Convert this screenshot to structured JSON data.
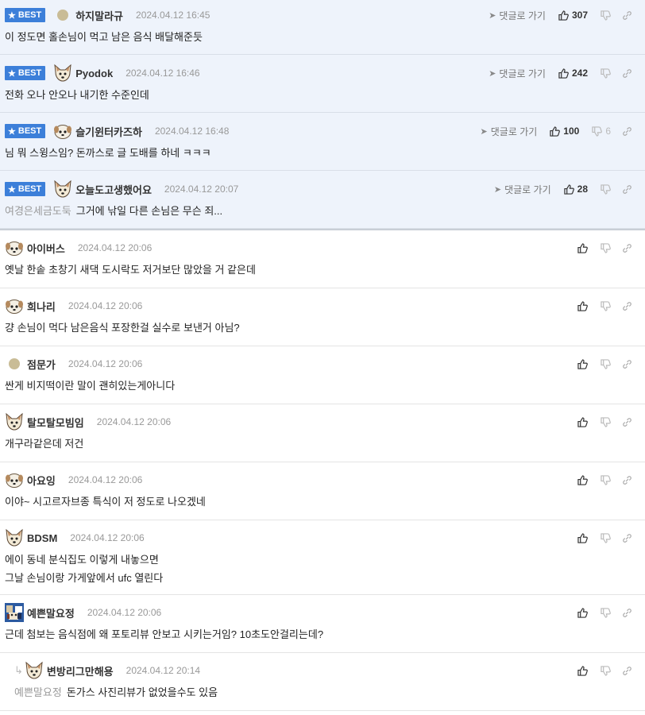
{
  "best_label": "BEST",
  "reply_link_label": "댓글로 가기",
  "best_comments": [
    {
      "avatar": "dot-avatar",
      "nick": "하지말라규",
      "date": "2024.04.12 16:45",
      "likes": "307",
      "dislikes": "",
      "quote": "",
      "text": "이 정도면 홀손님이 먹고 남은 음식 배달해준듯"
    },
    {
      "avatar": "fox-dog-avatar",
      "nick": "Pyodok",
      "date": "2024.04.12 16:46",
      "likes": "242",
      "dislikes": "",
      "quote": "",
      "text": "전화 오나 안오나 내기한 수준인데"
    },
    {
      "avatar": "puppy-avatar",
      "nick": "슬기윈터카즈하",
      "date": "2024.04.12 16:48",
      "likes": "100",
      "dislikes": "6",
      "quote": "",
      "text": "님 뭐 스윙스임? 돈까스로 글 도배를 하네 ㅋㅋㅋ"
    },
    {
      "avatar": "fox-dog-avatar",
      "nick": "오늘도고생했어요",
      "date": "2024.04.12 20:07",
      "likes": "28",
      "dislikes": "",
      "quote": "여경은세금도둑",
      "text": "그거에 낚일 다른 손님은 무슨 죄..."
    }
  ],
  "comments": [
    {
      "avatar": "puppy-avatar",
      "nick": "아이버스",
      "date": "2024.04.12 20:06",
      "lines": [
        "옛날 한솥 초창기 새댁 도시락도 저거보단 많았을 거 같은데"
      ]
    },
    {
      "avatar": "puppy-avatar",
      "nick": "희나리",
      "date": "2024.04.12 20:06",
      "lines": [
        "걍 손님이 먹다 남은음식 포장한걸 실수로 보낸거 아님?"
      ]
    },
    {
      "avatar": "dot-avatar",
      "nick": "점문가",
      "date": "2024.04.12 20:06",
      "lines": [
        "싼게 비지떡이란 말이 괜히있는게아니다"
      ]
    },
    {
      "avatar": "fox-dog-avatar",
      "nick": "탈모탈모빔임",
      "date": "2024.04.12 20:06",
      "lines": [
        "개구라같은데 저건"
      ]
    },
    {
      "avatar": "puppy-avatar",
      "nick": "아요잉",
      "date": "2024.04.12 20:06",
      "lines": [
        "이야~ 시고르자브종 특식이 저 정도로 나오겠네"
      ]
    },
    {
      "avatar": "fox-dog-avatar",
      "nick": "BDSM",
      "date": "2024.04.12 20:06",
      "lines": [
        "에이 동네 분식집도 이렇게 내놓으면",
        "그날 손님이랑 가게앞에서 ufc 열린다"
      ]
    },
    {
      "avatar": "pixel-avatar",
      "nick": "예쁜말요정",
      "date": "2024.04.12 20:06",
      "lines": [
        "근데 첨보는 음식점에 왜 포토리뷰 안보고 시키는거임? 10초도안걸리는데?"
      ]
    }
  ],
  "reply": {
    "avatar": "fox-dog-avatar",
    "nick": "변방리그만해용",
    "date": "2024.04.12 20:14",
    "quote": "예쁜말요정",
    "text": "돈가스 사진리뷰가 없었을수도 있음"
  }
}
